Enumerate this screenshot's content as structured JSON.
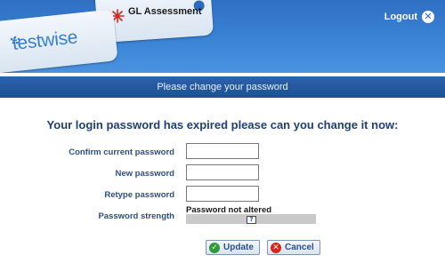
{
  "header": {
    "brand_partner": "GL Assessment",
    "brand_product": "testwise",
    "logout_label": "Logout",
    "icons": {
      "brand_mark": "gl-burst-icon",
      "logout": "close-circle-icon"
    },
    "colors": {
      "header_blue": "#3a84d6",
      "banner_blue": "#1e4f94",
      "label_blue": "#2b4f86"
    }
  },
  "banner": {
    "text": "Please change your password"
  },
  "form": {
    "heading": "Your login password has expired please can you change it now:",
    "fields": [
      {
        "label": "Confirm current password",
        "value": ""
      },
      {
        "label": "New password",
        "value": ""
      },
      {
        "label": "Retype password",
        "value": ""
      }
    ],
    "strength": {
      "label": "Password strength",
      "status": "Password not altered",
      "level": 0,
      "help_icon": "question-icon"
    },
    "buttons": {
      "update": "Update",
      "cancel": "Cancel",
      "update_icon": "check-icon",
      "cancel_icon": "cross-icon"
    }
  }
}
